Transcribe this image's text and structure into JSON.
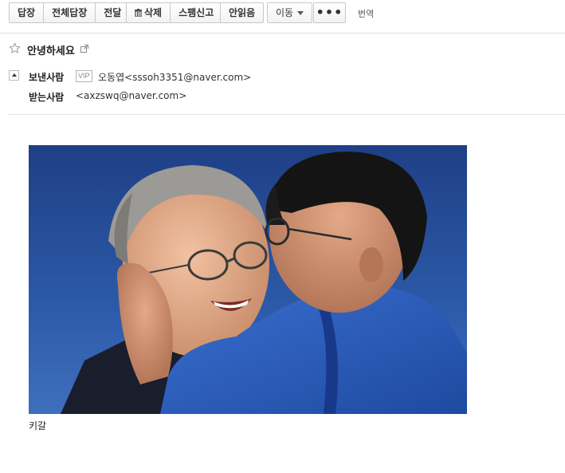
{
  "toolbar": {
    "reply_label": "답장",
    "reply_all_label": "전체답장",
    "forward_label": "전달",
    "delete_label": "삭제",
    "spam_label": "스팸신고",
    "unread_label": "안읽음",
    "move_label": "이동",
    "more_label": "•••",
    "translate_label": "번역"
  },
  "mail": {
    "subject": "안녕하세요",
    "sender_label": "보낸사람",
    "vip_badge": "VIP",
    "sender": "오동엽<sssoh3351@naver.com>",
    "recipient_label": "받는사람",
    "recipient": "<axzswq@naver.com>"
  },
  "body": {
    "caption": "키갈"
  },
  "icons": {
    "star": "star-outline-icon",
    "popout": "external-link-icon",
    "collapse": "collapse-toggle-icon",
    "trash": "trash-icon",
    "caret": "caret-down-icon"
  },
  "colors": {
    "toolbar_border": "#c8c8c8",
    "divider": "#dcdcdc",
    "photo_background": "#2a4f8f"
  }
}
